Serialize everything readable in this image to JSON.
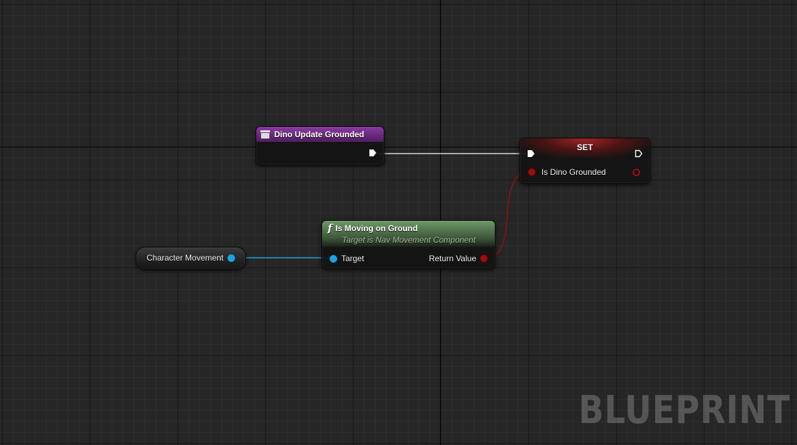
{
  "graph": {
    "watermark": "BLUEPRINT",
    "colors": {
      "event_header": "#6a2b7d",
      "set_header": "#7a1f1f",
      "function_header": "#5b7a55",
      "object_pin": "#1aa2e6",
      "bool_pin": "#9a0e0e",
      "exec_wire": "#d8d8d8"
    }
  },
  "nodes": {
    "event": {
      "title": "Dino Update Grounded",
      "icon": "event-icon"
    },
    "set": {
      "title": "SET",
      "input_label": "Is Dino Grounded"
    },
    "function": {
      "title": "Is Moving on Ground",
      "subtitle": "Target is Nav Movement Component",
      "icon_glyph": "f",
      "target_label": "Target",
      "return_label": "Return Value"
    },
    "variable": {
      "label": "Character Movement"
    }
  }
}
